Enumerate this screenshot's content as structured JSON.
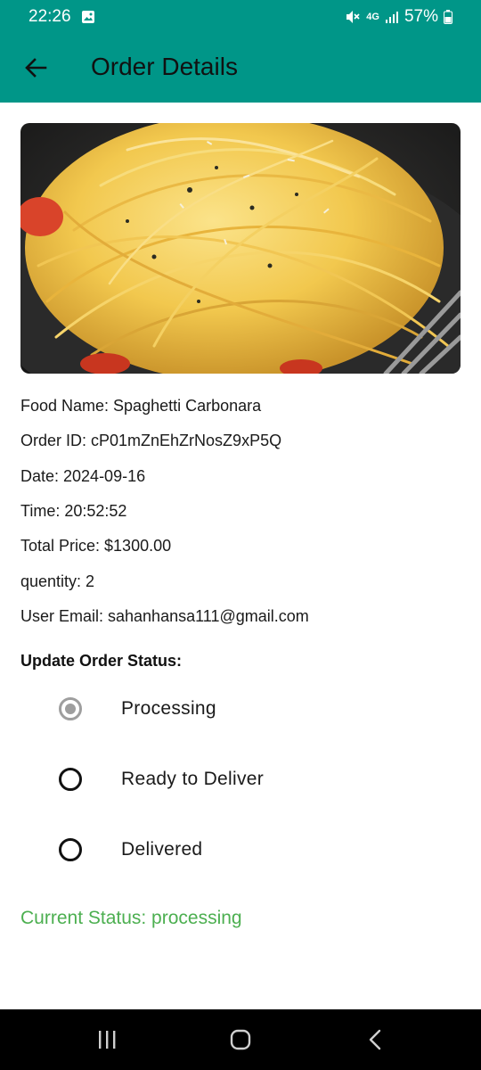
{
  "status_bar": {
    "time": "22:26",
    "network": "4G",
    "battery": "57%"
  },
  "app_bar": {
    "title": "Order Details"
  },
  "food_image": {
    "subject": "spaghetti carbonara plate"
  },
  "order": {
    "food_name": "Food Name: Spaghetti Carbonara",
    "order_id": "Order ID: cP01mZnEhZrNosZ9xP5Q",
    "date": "Date: 2024-09-16",
    "time": "Time: 20:52:52",
    "total_price": "Total Price: $1300.00",
    "quantity": "quentity: 2",
    "user_email": "User Email: sahanhansa111@gmail.com"
  },
  "status_section": {
    "title": "Update Order Status:",
    "options": [
      {
        "label": "Processing",
        "selected": true
      },
      {
        "label": "Ready to Deliver",
        "selected": false
      },
      {
        "label": "Delivered",
        "selected": false
      }
    ],
    "current": "Current Status: processing"
  },
  "colors": {
    "primary": "#009688",
    "status_text": "#4caf50",
    "radio_selected": "#9e9e9e"
  },
  "nav_bar": {
    "icons": [
      "recent-apps-icon",
      "home-icon",
      "back-icon"
    ]
  }
}
